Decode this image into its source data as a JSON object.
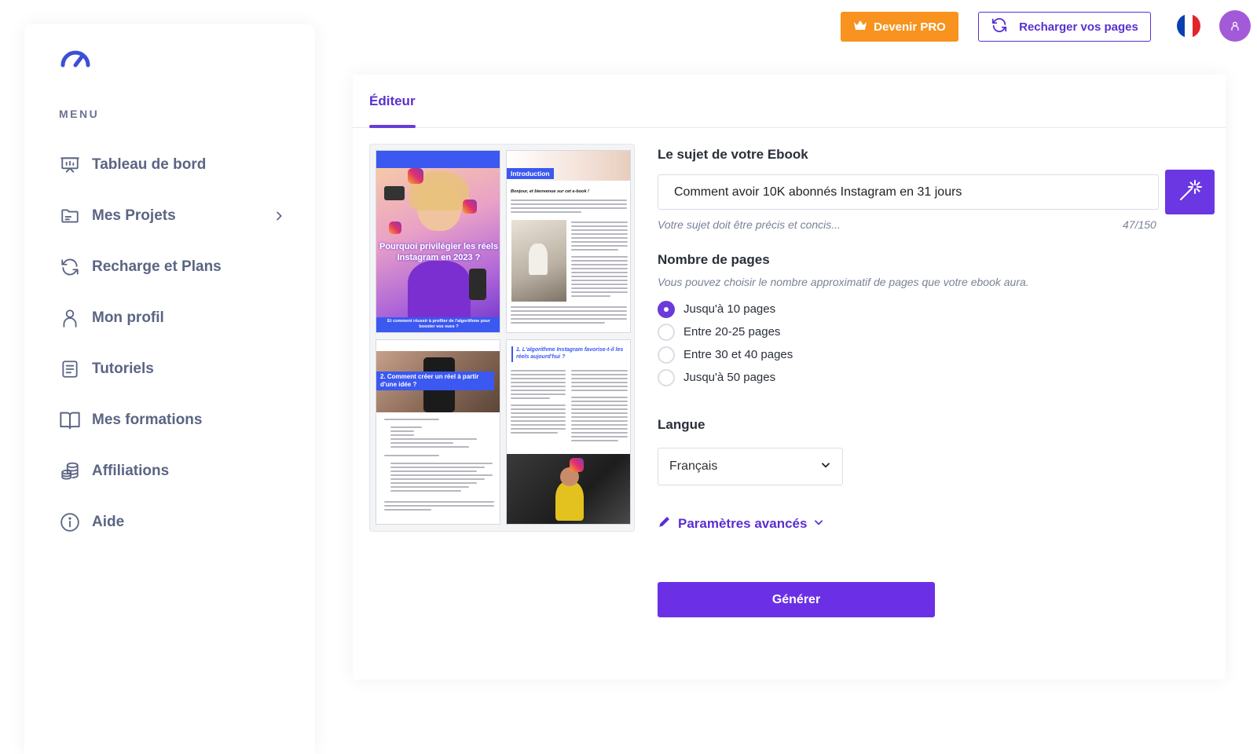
{
  "sidebar": {
    "menu_heading": "MENU",
    "items": [
      {
        "label": "Tableau de bord",
        "icon": "dashboard-icon"
      },
      {
        "label": "Mes Projets",
        "icon": "folder-icon",
        "has_chevron": true
      },
      {
        "label": "Recharge et Plans",
        "icon": "refresh-icon"
      },
      {
        "label": "Mon profil",
        "icon": "user-icon"
      },
      {
        "label": "Tutoriels",
        "icon": "document-icon"
      },
      {
        "label": "Mes formations",
        "icon": "book-icon"
      },
      {
        "label": "Affiliations",
        "icon": "coins-icon"
      },
      {
        "label": "Aide",
        "icon": "info-icon"
      }
    ]
  },
  "header": {
    "pro_button": "Devenir PRO",
    "reload_button": "Recharger vos pages",
    "language_flag": "fr-flag-icon",
    "avatar": "user-avatar-icon"
  },
  "editor": {
    "tab": "Éditeur",
    "preview": {
      "cover_title": "Pourquoi privilégier les réels Instagram en 2023 ?",
      "cover_subtitle": "Et comment réussir à profiter de l'algorithme pour booster vos vues ?",
      "page2_banner": "Introduction",
      "page2_heading": "Bonjour, et bienvenue sur cet e-book !",
      "page3_banner": "2. Comment créer un réel à partir d'une idée ?",
      "page4_heading": "1. L'algorithme Instagram favorise-t-il les réels aujourd'hui ?"
    },
    "subject": {
      "label": "Le sujet de votre Ebook",
      "value": "Comment avoir 10K abonnés Instagram en 31 jours",
      "hint": "Votre sujet doit être précis et concis...",
      "counter": "47/150"
    },
    "pages": {
      "label": "Nombre de pages",
      "hint": "Vous pouvez choisir le nombre approximatif de pages que votre ebook aura.",
      "options": [
        "Jusqu'à 10 pages",
        "Entre 20-25 pages",
        "Entre 30 et 40 pages",
        "Jusqu'à 50 pages"
      ],
      "selected_index": 0
    },
    "language": {
      "label": "Langue",
      "selected": "Français"
    },
    "advanced": "Paramètres avancés",
    "generate": "Générer"
  },
  "colors": {
    "accent": "#6b30e6",
    "pro": "#f7931e",
    "sidebar_text": "#5b6583"
  }
}
